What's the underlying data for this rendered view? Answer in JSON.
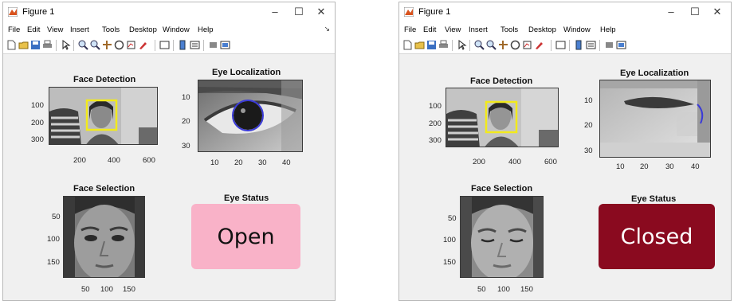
{
  "windows": [
    {
      "title": "Figure 1",
      "menu": [
        "File",
        "Edit",
        "View",
        "Insert",
        "Tools",
        "Desktop",
        "Window",
        "Help"
      ],
      "panels": {
        "face_detection": {
          "title": "Face Detection",
          "yticks": [
            "100",
            "200",
            "300"
          ],
          "xticks": [
            "200",
            "400",
            "600"
          ]
        },
        "eye_localization": {
          "title": "Eye Localization",
          "yticks": [
            "10",
            "20",
            "30"
          ],
          "xticks": [
            "10",
            "20",
            "30",
            "40"
          ]
        },
        "face_selection": {
          "title": "Face Selection",
          "yticks": [
            "50",
            "100",
            "150"
          ],
          "xticks": [
            "50",
            "100",
            "150"
          ]
        },
        "eye_status": {
          "title": "Eye Status",
          "value": "Open"
        }
      },
      "colors": {
        "status_bg": "#f9b2c8",
        "status_text": "#111111",
        "bbox": "#f2ea1c",
        "iris": "#3a3ad8"
      }
    },
    {
      "title": "Figure 1",
      "menu": [
        "File",
        "Edit",
        "View",
        "Insert",
        "Tools",
        "Desktop",
        "Window",
        "Help"
      ],
      "panels": {
        "face_detection": {
          "title": "Face Detection",
          "yticks": [
            "100",
            "200",
            "300"
          ],
          "xticks": [
            "200",
            "400",
            "600"
          ]
        },
        "eye_localization": {
          "title": "Eye Localization",
          "yticks": [
            "10",
            "20",
            "30"
          ],
          "xticks": [
            "10",
            "20",
            "30",
            "40"
          ]
        },
        "face_selection": {
          "title": "Face Selection",
          "yticks": [
            "50",
            "100",
            "150"
          ],
          "xticks": [
            "50",
            "100",
            "150"
          ]
        },
        "eye_status": {
          "title": "Eye Status",
          "value": "Closed"
        }
      },
      "colors": {
        "status_bg": "#8a0a1f",
        "status_text": "#ffffff",
        "bbox": "#f2ea1c",
        "iris": "#3a3ad8"
      }
    }
  ]
}
